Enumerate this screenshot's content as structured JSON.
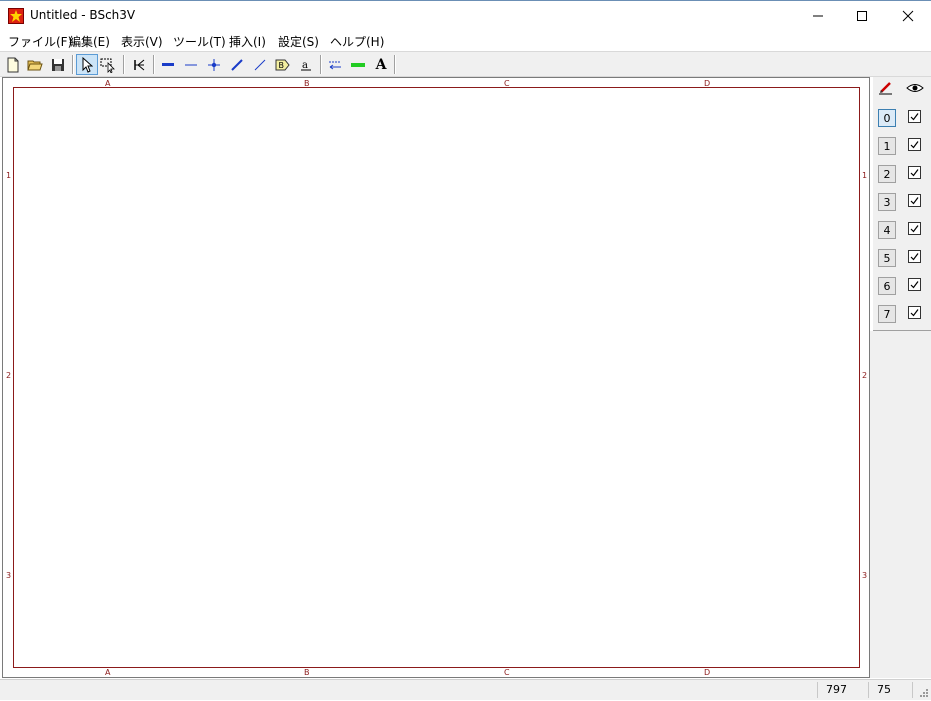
{
  "window": {
    "title": "Untitled - BSch3V",
    "minimize_glyph": "—",
    "close_glyph": "✕"
  },
  "menu": {
    "items": [
      "ファイル(F)",
      "編集(E)",
      "表示(V)",
      "ツール(T)",
      "挿入(I)",
      "設定(S)",
      "ヘルプ(H)"
    ]
  },
  "toolbar": {
    "buttons": [
      "new-file-icon",
      "open-folder-icon",
      "save-disk-icon",
      "pointer-select-icon",
      "drag-select-icon",
      "cross-probe-icon",
      "bus-icon",
      "wire-icon",
      "junction-icon",
      "bus-entry-icon",
      "wire-entry-icon",
      "tag-icon",
      "label-icon",
      "comment-icon",
      "marker-line-icon",
      "text-icon"
    ],
    "text_button_glyph": "A"
  },
  "sheet": {
    "columns": [
      "A",
      "B",
      "C",
      "D"
    ],
    "rows": [
      "1",
      "2",
      "3"
    ],
    "border_color": "#8b1a1a"
  },
  "layers": {
    "labels": [
      "0",
      "1",
      "2",
      "3",
      "4",
      "5",
      "6",
      "7"
    ],
    "selected": "0",
    "all_visible": true
  },
  "status": {
    "x": "797",
    "y": "75"
  }
}
